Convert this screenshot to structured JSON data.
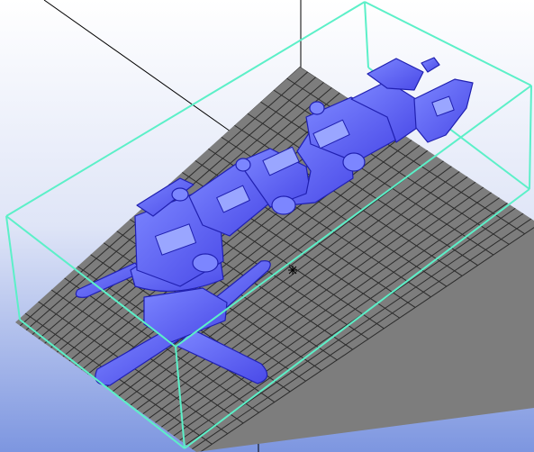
{
  "viewport": {
    "name": "3d-model-viewport",
    "background_top": "#ffffff",
    "background_bottom": "#7d96e0"
  },
  "colors": {
    "build_plate": "#7d7d7d",
    "grid_lines": "#2c2c2c",
    "bounding_box": "#5cf0c8",
    "model_fill": "#5a5cf6",
    "model_highlight": "#9aa6ff",
    "model_edge": "#2020b0",
    "axis_lines": "#000000"
  },
  "grid": {
    "rows": 22,
    "cols": 30
  },
  "icons": {
    "pivot_marker": "pivot-cross-icon"
  }
}
